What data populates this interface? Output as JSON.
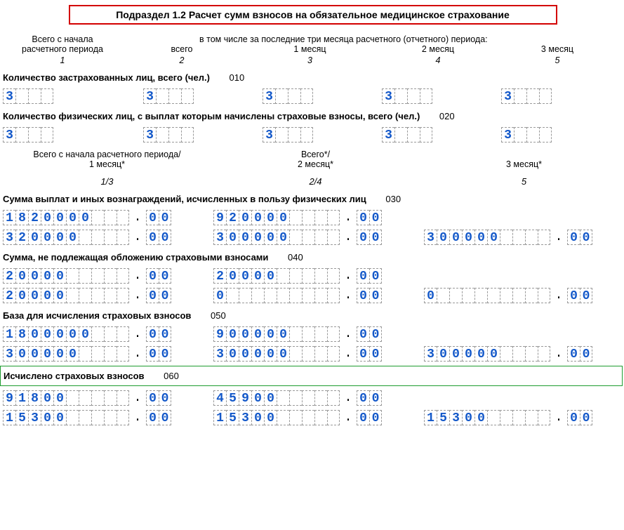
{
  "title": "Подраздел 1.2 Расчет сумм взносов на обязательное медицинское страхование",
  "hdr5": {
    "col1_l1": "Всего с начала",
    "col1_l2": "расчетного периода",
    "span4": "в том числе за последние три месяца расчетного (отчетного) периода:",
    "col2": "всего",
    "col3": "1 месяц",
    "col4": "2 месяц",
    "col5": "3 месяц",
    "n1": "1",
    "n2": "2",
    "n3": "3",
    "n4": "4",
    "n5": "5"
  },
  "sect010": {
    "label": "Количество застрахованных лиц, всего (чел.)",
    "code": "010",
    "cells": {
      "c1": [
        "3",
        "",
        "",
        ""
      ],
      "c2": [
        "3",
        "",
        "",
        ""
      ],
      "c3": [
        "3",
        "",
        "",
        ""
      ],
      "c4": [
        "3",
        "",
        "",
        ""
      ],
      "c5": [
        "3",
        "",
        "",
        ""
      ]
    }
  },
  "sect020": {
    "label": "Количество физических лиц, с выплат которым начислены страховые взносы, всего (чел.)",
    "code": "020",
    "cells": {
      "c1": [
        "3",
        "",
        "",
        ""
      ],
      "c2": [
        "3",
        "",
        "",
        ""
      ],
      "c3": [
        "3",
        "",
        "",
        ""
      ],
      "c4": [
        "3",
        "",
        "",
        ""
      ],
      "c5": [
        "3",
        "",
        "",
        ""
      ]
    }
  },
  "hdr3": {
    "c1_l1": "Всего с начала расчетного периода/",
    "c1_l2": "1 месяц*",
    "c2_l1": "Всего*/",
    "c2_l2": "2 месяц*",
    "c3_l2": "3 месяц*",
    "n1": "1/3",
    "n2": "2/4",
    "n3": "5"
  },
  "sect030": {
    "label": "Сумма выплат и иных вознаграждений, исчисленных в пользу физических лиц",
    "code": "030",
    "row1": {
      "a_int": [
        "1",
        "8",
        "2",
        "0",
        "0",
        "0",
        "0",
        "",
        "",
        ""
      ],
      "a_dec": [
        "0",
        "0"
      ],
      "b_int": [
        "9",
        "2",
        "0",
        "0",
        "0",
        "0",
        "",
        "",
        "",
        ""
      ],
      "b_dec": [
        "0",
        "0"
      ]
    },
    "row2": {
      "a_int": [
        "3",
        "2",
        "0",
        "0",
        "0",
        "0",
        "",
        "",
        "",
        ""
      ],
      "a_dec": [
        "0",
        "0"
      ],
      "b_int": [
        "3",
        "0",
        "0",
        "0",
        "0",
        "0",
        "",
        "",
        "",
        ""
      ],
      "b_dec": [
        "0",
        "0"
      ],
      "c_int": [
        "3",
        "0",
        "0",
        "0",
        "0",
        "0",
        "",
        "",
        "",
        ""
      ],
      "c_dec": [
        "0",
        "0"
      ]
    }
  },
  "sect040": {
    "label": "Сумма, не подлежащая обложению страховыми взносами",
    "code": "040",
    "row1": {
      "a_int": [
        "2",
        "0",
        "0",
        "0",
        "0",
        "",
        "",
        "",
        "",
        ""
      ],
      "a_dec": [
        "0",
        "0"
      ],
      "b_int": [
        "2",
        "0",
        "0",
        "0",
        "0",
        "",
        "",
        "",
        "",
        ""
      ],
      "b_dec": [
        "0",
        "0"
      ]
    },
    "row2": {
      "a_int": [
        "2",
        "0",
        "0",
        "0",
        "0",
        "",
        "",
        "",
        "",
        ""
      ],
      "a_dec": [
        "0",
        "0"
      ],
      "b_int": [
        "0",
        "",
        "",
        "",
        "",
        "",
        "",
        "",
        "",
        ""
      ],
      "b_dec": [
        "0",
        "0"
      ],
      "c_int": [
        "0",
        "",
        "",
        "",
        "",
        "",
        "",
        "",
        "",
        ""
      ],
      "c_dec": [
        "0",
        "0"
      ]
    }
  },
  "sect050": {
    "label": "База для исчисления страховых взносов",
    "code": "050",
    "row1": {
      "a_int": [
        "1",
        "8",
        "0",
        "0",
        "0",
        "0",
        "0",
        "",
        "",
        ""
      ],
      "a_dec": [
        "0",
        "0"
      ],
      "b_int": [
        "9",
        "0",
        "0",
        "0",
        "0",
        "0",
        "",
        "",
        "",
        ""
      ],
      "b_dec": [
        "0",
        "0"
      ]
    },
    "row2": {
      "a_int": [
        "3",
        "0",
        "0",
        "0",
        "0",
        "0",
        "",
        "",
        "",
        ""
      ],
      "a_dec": [
        "0",
        "0"
      ],
      "b_int": [
        "3",
        "0",
        "0",
        "0",
        "0",
        "0",
        "",
        "",
        "",
        ""
      ],
      "b_dec": [
        "0",
        "0"
      ],
      "c_int": [
        "3",
        "0",
        "0",
        "0",
        "0",
        "0",
        "",
        "",
        "",
        ""
      ],
      "c_dec": [
        "0",
        "0"
      ]
    }
  },
  "sect060": {
    "label": "Исчислено страховых взносов",
    "code": "060",
    "row1": {
      "a_int": [
        "9",
        "1",
        "8",
        "0",
        "0",
        "",
        "",
        "",
        "",
        ""
      ],
      "a_dec": [
        "0",
        "0"
      ],
      "b_int": [
        "4",
        "5",
        "9",
        "0",
        "0",
        "",
        "",
        "",
        "",
        ""
      ],
      "b_dec": [
        "0",
        "0"
      ]
    },
    "row2": {
      "a_int": [
        "1",
        "5",
        "3",
        "0",
        "0",
        "",
        "",
        "",
        "",
        ""
      ],
      "a_dec": [
        "0",
        "0"
      ],
      "b_int": [
        "1",
        "5",
        "3",
        "0",
        "0",
        "",
        "",
        "",
        "",
        ""
      ],
      "b_dec": [
        "0",
        "0"
      ],
      "c_int": [
        "1",
        "5",
        "3",
        "0",
        "0",
        "",
        "",
        "",
        "",
        ""
      ],
      "c_dec": [
        "0",
        "0"
      ]
    }
  }
}
